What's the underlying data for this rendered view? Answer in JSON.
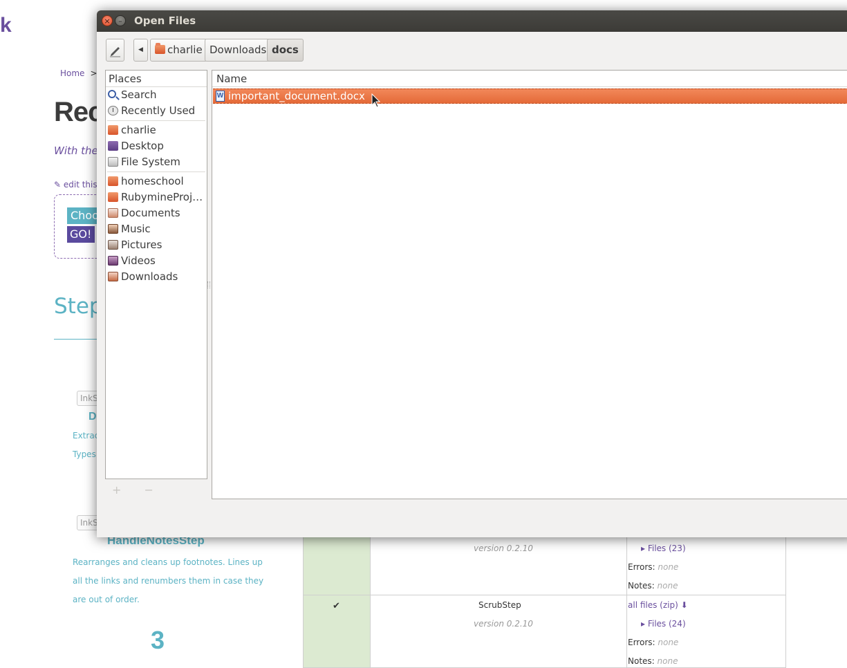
{
  "background_page": {
    "logo_fragment": "k",
    "breadcrumb": {
      "home": "Home",
      "sep": ">>"
    },
    "title_fragment": "Rec",
    "subtitle_fragment": "With the",
    "edit_link": "edit this",
    "choose_button": "Choo",
    "go_button": "GO!",
    "steps_heading_fragment": "Step",
    "tag_1": "InkS",
    "tag_2": "InkS",
    "d_fragment": "D",
    "extract_fragment": "Extrac",
    "typeset_fragment": "Types",
    "step_name": "HandleNotesStep",
    "step_description": "Rearranges and cleans up footnotes. Lines up all the links and renumbers them in case they are out of order.",
    "step_number": "3",
    "table": {
      "row1": {
        "version": "version 0.2.10",
        "files": "Files (23)",
        "errors_label": "Errors:",
        "errors_value": "none",
        "notes_label": "Notes:",
        "notes_value": "none"
      },
      "row2": {
        "check": "✔",
        "name": "ScrubStep",
        "version": "version 0.2.10",
        "all_files": "all files (zip)",
        "files": "Files (24)",
        "errors_label": "Errors:",
        "errors_value": "none",
        "notes_label": "Notes:",
        "notes_value": "none"
      }
    }
  },
  "dialog": {
    "title": "Open Files",
    "close_glyph": "×",
    "min_glyph": "–",
    "pathbar": [
      {
        "label": "charlie",
        "icon": "home-folder-icon",
        "active": false
      },
      {
        "label": "Downloads",
        "active": false
      },
      {
        "label": "docs",
        "active": true
      }
    ],
    "places": {
      "header": "Places",
      "items": [
        {
          "label": "Search",
          "icon": "search-icon"
        },
        {
          "label": "Recently Used",
          "icon": "clock-icon"
        },
        {
          "label": "charlie",
          "icon": "home-folder-icon"
        },
        {
          "label": "Desktop",
          "icon": "desktop-icon"
        },
        {
          "label": "File System",
          "icon": "drive-icon"
        },
        {
          "label": "homeschool",
          "icon": "folder-icon"
        },
        {
          "label": "RubymineProje…",
          "icon": "folder-icon"
        },
        {
          "label": "Documents",
          "icon": "documents-folder-icon"
        },
        {
          "label": "Music",
          "icon": "music-folder-icon"
        },
        {
          "label": "Pictures",
          "icon": "pictures-folder-icon"
        },
        {
          "label": "Videos",
          "icon": "videos-folder-icon"
        },
        {
          "label": "Downloads",
          "icon": "downloads-folder-icon"
        }
      ],
      "add_remove": "+ −"
    },
    "files": {
      "column_header": "Name",
      "rows": [
        {
          "name": "important_document.docx",
          "icon": "word-document-icon",
          "selected": true
        }
      ]
    }
  },
  "colors": {
    "selection": "#e9733f",
    "titlebar": "#3c3b37",
    "accent_purple": "#6a4f9e",
    "accent_teal": "#5cb3c4"
  }
}
